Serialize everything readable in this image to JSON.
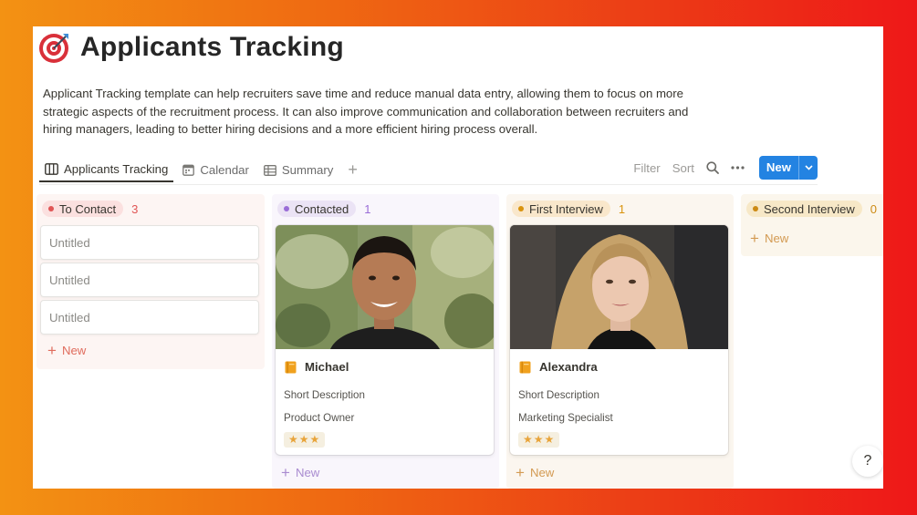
{
  "page": {
    "title": "Applicants Tracking",
    "icon": "target-icon",
    "description": "Applicant Tracking template can help recruiters save time and reduce manual data entry, allowing them to focus on more strategic aspects of the recruitment process. It can also improve communication and collaboration between recruiters and hiring managers, leading to better hiring decisions and a more efficient hiring process overall."
  },
  "tabs": [
    {
      "label": "Applicants Tracking",
      "icon": "board-icon",
      "active": true
    },
    {
      "label": "Calendar",
      "icon": "calendar-icon",
      "active": false
    },
    {
      "label": "Summary",
      "icon": "table-icon",
      "active": false
    }
  ],
  "toolbar": {
    "filter_label": "Filter",
    "sort_label": "Sort",
    "new_label": "New"
  },
  "columns": [
    {
      "name": "To Contact",
      "count": "3",
      "dot_color": "#e05555",
      "pill_bg": "#fbe0df",
      "col_bg": "#fdf5f3",
      "count_color": "#e05555",
      "cards": [
        "Untitled",
        "Untitled",
        "Untitled"
      ],
      "new_label": "New",
      "new_color": "#e06c5d"
    },
    {
      "name": "Contacted",
      "count": "1",
      "dot_color": "#9a6dd7",
      "pill_bg": "#ebe3f5",
      "col_bg": "#f9f6fc",
      "count_color": "#9a6dd7",
      "new_label": "New",
      "new_color": "#a98bd0"
    },
    {
      "name": "First Interview",
      "count": "1",
      "dot_color": "#d9930d",
      "pill_bg": "#f9e7cb",
      "col_bg": "#fbf6ef",
      "count_color": "#d9930d",
      "new_label": "New",
      "new_color": "#d39a52"
    },
    {
      "name": "Second Interview",
      "count": "0",
      "dot_color": "#cc8a14",
      "pill_bg": "#f7e8c7",
      "col_bg": "#fbf6ec",
      "count_color": "#cc8a14",
      "new_label": "New",
      "new_color": "#d39a52"
    }
  ],
  "cards": [
    {
      "name": "Michael",
      "description": "Short Description",
      "role": "Product Owner",
      "rating": "★★★"
    },
    {
      "name": "Alexandra",
      "description": "Short Description",
      "role": "Marketing Specialist",
      "rating": "★★★"
    }
  ],
  "help_label": "?"
}
